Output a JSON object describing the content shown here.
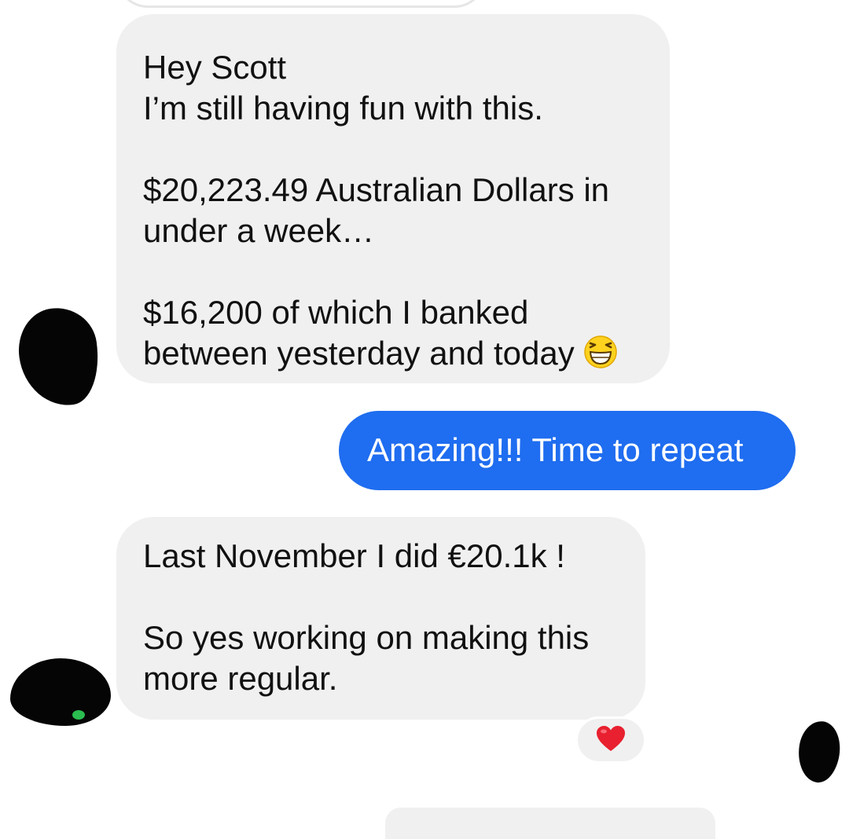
{
  "messages": [
    {
      "direction": "incoming",
      "text": "Hey Scott\nI’m still having fun with this.\n\n$20,223.49 Australian Dollars in\nunder a week…\n\n$16,200 of which I banked\nbetween yesterday and today ",
      "emoji": "grinning-squinting-face"
    },
    {
      "direction": "outgoing",
      "text": "Amazing!!! Time to repeat"
    },
    {
      "direction": "incoming",
      "text": "Last November I did €20.1k !\n\nSo yes working on making this\nmore regular.",
      "reaction": "heart"
    }
  ],
  "colors": {
    "incoming_bubble": "#f0f0f0",
    "outgoing_bubble": "#1f6df0",
    "reaction_heart": "#e8202f"
  }
}
